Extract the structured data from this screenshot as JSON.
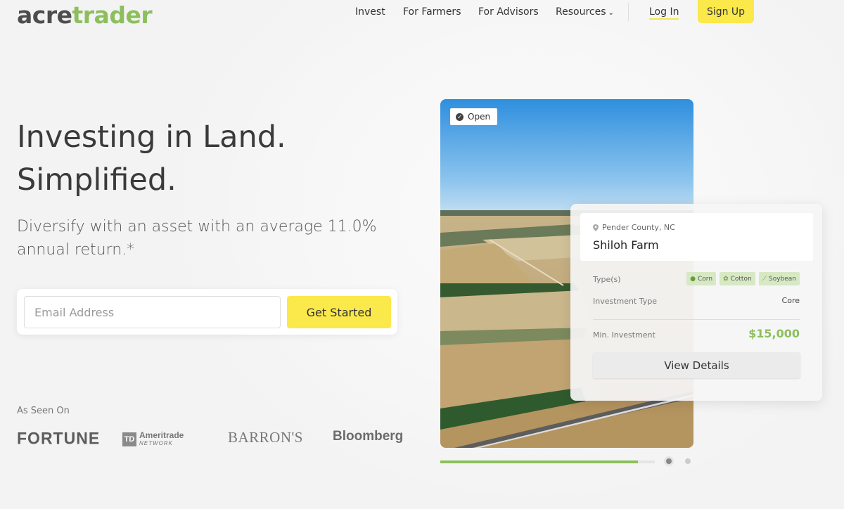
{
  "brand": {
    "part1": "acre",
    "part2": "trader"
  },
  "nav": {
    "items": [
      "Invest",
      "For Farmers",
      "For Advisors",
      "Resources"
    ],
    "resources_chevron": "⌄",
    "login": "Log In",
    "signup": "Sign Up"
  },
  "hero": {
    "title_line1": "Investing in Land.",
    "title_line2": "Simplified.",
    "subtitle": "Diversify with an asset with an average 11.0% annual return.*",
    "email_placeholder": "Email Address",
    "cta": "Get Started"
  },
  "press": {
    "label": "As Seen On",
    "logos": [
      "FORTUNE",
      "TD",
      "Ameritrade",
      "NETWORK",
      "BARRON'S",
      "Bloomberg"
    ]
  },
  "listing": {
    "status": "Open",
    "location": "Pender County, NC",
    "name": "Shiloh Farm",
    "types_label": "Type(s)",
    "types": [
      "Corn",
      "Cotton",
      "Soybean"
    ],
    "investment_type_label": "Investment Type",
    "investment_type": "Core",
    "min_investment_label": "Min. Investment",
    "min_investment": "$15,000",
    "button": "View Details"
  },
  "carousel": {
    "progress": 0.92,
    "slides": 2,
    "active_slide": 1
  },
  "colors": {
    "accent_green": "#8cbf5c",
    "accent_yellow": "#fbe84a",
    "text_dark": "#333333"
  },
  "icons": [
    "check-circle-icon",
    "map-pin-icon",
    "corn-icon",
    "cotton-icon",
    "soybean-icon",
    "chevron-down-icon"
  ]
}
